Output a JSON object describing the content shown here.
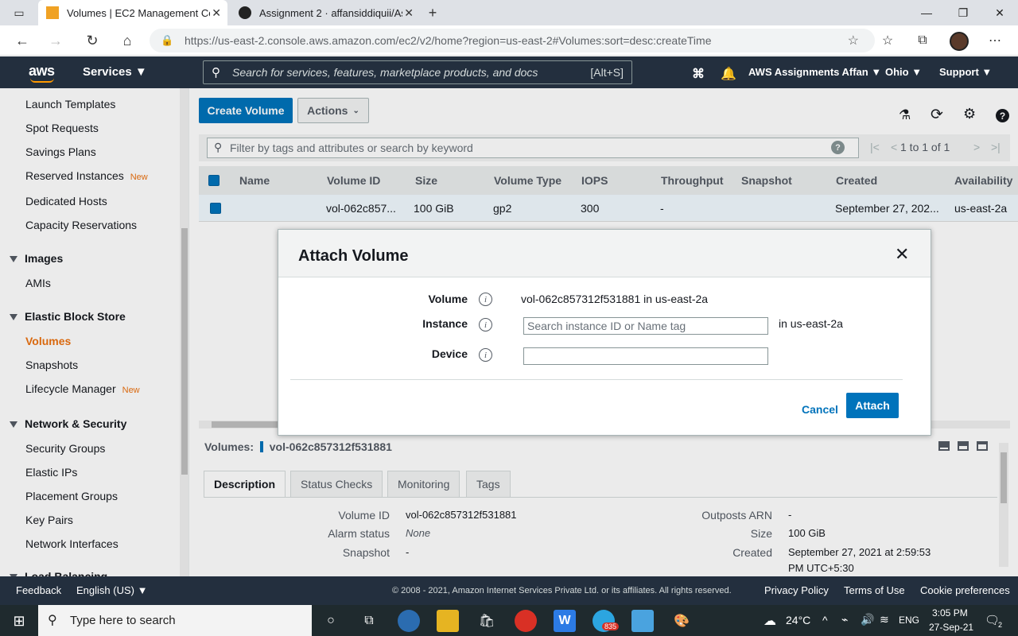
{
  "browser": {
    "tabs": [
      {
        "title": "Volumes | EC2 Management Con",
        "active": true
      },
      {
        "title": "Assignment 2 · affansiddiquii/As",
        "active": false
      }
    ],
    "url": "https://us-east-2.console.aws.amazon.com/ec2/v2/home?region=us-east-2#Volumes:sort=desc:createTime"
  },
  "aws_nav": {
    "logo": "aws",
    "services": "Services ▼",
    "search_placeholder": "Search for services, features, marketplace products, and docs",
    "search_shortcut": "[Alt+S]",
    "account": "AWS Assignments Affan ▼",
    "region": "Ohio ▼",
    "support": "Support ▼"
  },
  "sidebar": {
    "items_top": [
      {
        "label": "Launch Templates",
        "badge": ""
      },
      {
        "label": "Spot Requests",
        "badge": ""
      },
      {
        "label": "Savings Plans",
        "badge": ""
      },
      {
        "label": "Reserved Instances",
        "badge": "New"
      },
      {
        "label": "Dedicated Hosts",
        "badge": ""
      },
      {
        "label": "Capacity Reservations",
        "badge": ""
      }
    ],
    "sections": [
      {
        "title": "Images",
        "items": [
          "AMIs"
        ]
      },
      {
        "title": "Elastic Block Store",
        "items": [
          "Volumes",
          "Snapshots",
          "Lifecycle Manager"
        ]
      },
      {
        "title": "Network & Security",
        "items": [
          "Security Groups",
          "Elastic IPs",
          "Placement Groups",
          "Key Pairs",
          "Network Interfaces"
        ]
      },
      {
        "title": "Load Balancing",
        "items": []
      }
    ],
    "lifecycle_badge": "New",
    "active_item": "Volumes"
  },
  "toolbar": {
    "create_label": "Create Volume",
    "actions_label": "Actions"
  },
  "filter": {
    "placeholder": "Filter by tags and attributes or search by keyword",
    "pagination": "1 to 1 of 1"
  },
  "table": {
    "columns": [
      "Name",
      "Volume ID",
      "Size",
      "Volume Type",
      "IOPS",
      "Throughput",
      "Snapshot",
      "Created",
      "Availability"
    ],
    "row": {
      "name": "",
      "volume_id": "vol-062c857...",
      "size": "100 GiB",
      "type": "gp2",
      "iops": "300",
      "throughput": "-",
      "snapshot": "",
      "created": "September 27, 202...",
      "az": "us-east-2a"
    }
  },
  "details": {
    "title_prefix": "Volumes:",
    "title_id": "vol-062c857312f531881",
    "tabs": [
      "Description",
      "Status Checks",
      "Monitoring",
      "Tags"
    ],
    "left": [
      {
        "label": "Volume ID",
        "value": "vol-062c857312f531881"
      },
      {
        "label": "Alarm status",
        "value": "None"
      },
      {
        "label": "Snapshot",
        "value": "-"
      }
    ],
    "right": [
      {
        "label": "Outposts ARN",
        "value": "-"
      },
      {
        "label": "Size",
        "value": "100 GiB"
      },
      {
        "label": "Created",
        "value": "September 27, 2021 at 2:59:53"
      },
      {
        "label": "",
        "value": "PM UTC+5:30"
      }
    ]
  },
  "modal": {
    "title": "Attach Volume",
    "volume_label": "Volume",
    "volume_value": "vol-062c857312f531881 in us-east-2a",
    "instance_label": "Instance",
    "instance_placeholder": "Search instance ID or Name tag",
    "instance_suffix": "in us-east-2a",
    "device_label": "Device",
    "device_value": "",
    "cancel_label": "Cancel",
    "attach_label": "Attach"
  },
  "footer": {
    "feedback": "Feedback",
    "language": "English (US) ▼",
    "copyright": "© 2008 - 2021, Amazon Internet Services Private Ltd. or its affiliates. All rights reserved.",
    "privacy": "Privacy Policy",
    "terms": "Terms of Use",
    "cookies": "Cookie preferences"
  },
  "taskbar": {
    "search_placeholder": "Type here to search",
    "weather": "24°C",
    "lang": "ENG",
    "time": "3:05 PM",
    "date": "27-Sep-21",
    "telegram_badge": "835",
    "notif_count": "2"
  },
  "colors": {
    "aws_dark": "#232f3e",
    "aws_orange": "#ec7211",
    "aws_blue": "#0073bb"
  }
}
